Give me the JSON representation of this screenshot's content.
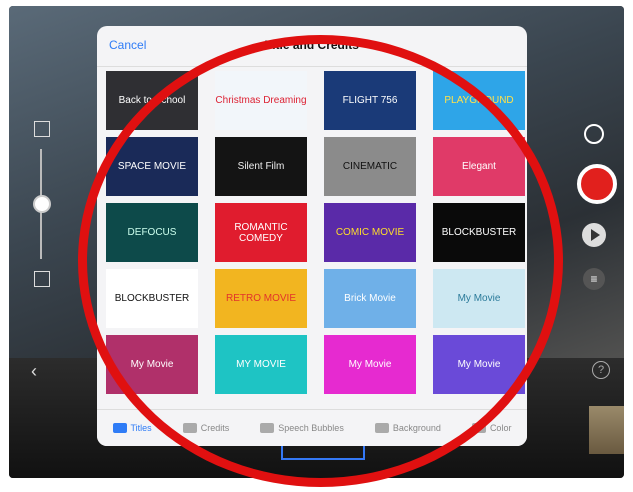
{
  "header": {
    "cancel_label": "Cancel",
    "title": "Title and Credits"
  },
  "tiles": [
    {
      "label": "Back to School",
      "bg": "#2f2f33",
      "color": "#fff"
    },
    {
      "label": "Christmas Dreaming",
      "bg": "#f2f6fa",
      "color": "#d23"
    },
    {
      "label": "FLIGHT 756",
      "bg": "#1a3a78",
      "color": "#fff"
    },
    {
      "label": "PLAYGROUND",
      "bg": "#2ea5e8",
      "color": "#ffe14a"
    },
    {
      "label": "SPACE MOVIE",
      "bg": "#1a2a58",
      "color": "#fff"
    },
    {
      "label": "Silent Film",
      "bg": "#141414",
      "color": "#eee"
    },
    {
      "label": "CINEMATIC",
      "bg": "#8b8b8b",
      "color": "#111"
    },
    {
      "label": "Elegant",
      "bg": "#e03a68",
      "color": "#fff"
    },
    {
      "label": "DEFOCUS",
      "bg": "#0d4a4a",
      "color": "#cfe"
    },
    {
      "label": "ROMANTIC COMEDY",
      "bg": "#e01c2e",
      "color": "#fff"
    },
    {
      "label": "COMIC MOVIE",
      "bg": "#5a2aa8",
      "color": "#ffde2a"
    },
    {
      "label": "BLOCKBUSTER",
      "bg": "#0a0a0a",
      "color": "#fff"
    },
    {
      "label": "BLOCKBUSTER",
      "bg": "#ffffff",
      "color": "#111"
    },
    {
      "label": "RETRO MOVIE",
      "bg": "#f2b520",
      "color": "#e2342a"
    },
    {
      "label": "Brick Movie",
      "bg": "#6fb0e8",
      "color": "#fff"
    },
    {
      "label": "My Movie",
      "bg": "#cde8f2",
      "color": "#2a7a9a"
    },
    {
      "label": "My Movie",
      "bg": "#b0306a",
      "color": "#fff"
    },
    {
      "label": "MY MOVIE",
      "bg": "#1ec4c4",
      "color": "#fff"
    },
    {
      "label": "My Movie",
      "bg": "#e62ad0",
      "color": "#fff"
    },
    {
      "label": "My Movie",
      "bg": "#6a4ad8",
      "color": "#fff"
    }
  ],
  "tabs": [
    {
      "label": "Titles"
    },
    {
      "label": "Credits"
    },
    {
      "label": "Speech Bubbles"
    },
    {
      "label": "Background"
    },
    {
      "label": "Color"
    }
  ],
  "colors": {
    "accent": "#2f7cf6",
    "record": "#e1201d",
    "annotation_ring": "#e01010"
  }
}
